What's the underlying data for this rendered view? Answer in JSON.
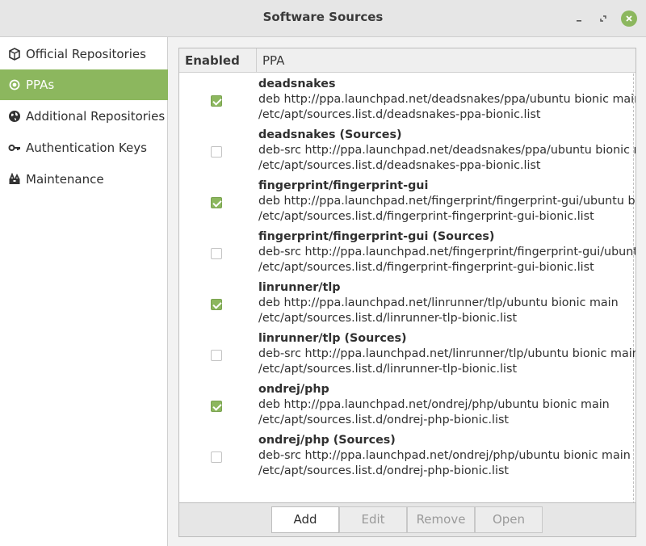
{
  "window": {
    "title": "Software Sources",
    "accent_color": "#8cb75e"
  },
  "window_controls": [
    "minimize-icon",
    "maximize-icon",
    "close-icon"
  ],
  "sidebar": {
    "items": [
      {
        "label": "Official Repositories",
        "icon": "package-icon",
        "active": false
      },
      {
        "label": "PPAs",
        "icon": "radio-dot-icon",
        "active": true
      },
      {
        "label": "Additional Repositories",
        "icon": "globe-icon",
        "active": false
      },
      {
        "label": "Authentication Keys",
        "icon": "key-icon",
        "active": false
      },
      {
        "label": "Maintenance",
        "icon": "toolbox-icon",
        "active": false
      }
    ]
  },
  "table": {
    "columns": [
      "Enabled",
      "PPA"
    ],
    "rows": [
      {
        "enabled": true,
        "name": "deadsnakes",
        "line": "deb http://ppa.launchpad.net/deadsnakes/ppa/ubuntu bionic main",
        "file": "/etc/apt/sources.list.d/deadsnakes-ppa-bionic.list"
      },
      {
        "enabled": false,
        "name": "deadsnakes (Sources)",
        "line": "deb-src http://ppa.launchpad.net/deadsnakes/ppa/ubuntu bionic main",
        "file": "/etc/apt/sources.list.d/deadsnakes-ppa-bionic.list"
      },
      {
        "enabled": true,
        "name": "fingerprint/fingerprint-gui",
        "line": "deb http://ppa.launchpad.net/fingerprint/fingerprint-gui/ubuntu bionic main",
        "file": "/etc/apt/sources.list.d/fingerprint-fingerprint-gui-bionic.list"
      },
      {
        "enabled": false,
        "name": "fingerprint/fingerprint-gui (Sources)",
        "line": "deb-src http://ppa.launchpad.net/fingerprint/fingerprint-gui/ubuntu bionic main",
        "file": "/etc/apt/sources.list.d/fingerprint-fingerprint-gui-bionic.list"
      },
      {
        "enabled": true,
        "name": "linrunner/tlp",
        "line": "deb http://ppa.launchpad.net/linrunner/tlp/ubuntu bionic main",
        "file": "/etc/apt/sources.list.d/linrunner-tlp-bionic.list"
      },
      {
        "enabled": false,
        "name": "linrunner/tlp (Sources)",
        "line": "deb-src http://ppa.launchpad.net/linrunner/tlp/ubuntu bionic main",
        "file": "/etc/apt/sources.list.d/linrunner-tlp-bionic.list"
      },
      {
        "enabled": true,
        "name": "ondrej/php",
        "line": "deb http://ppa.launchpad.net/ondrej/php/ubuntu bionic main",
        "file": "/etc/apt/sources.list.d/ondrej-php-bionic.list"
      },
      {
        "enabled": false,
        "name": "ondrej/php (Sources)",
        "line": "deb-src http://ppa.launchpad.net/ondrej/php/ubuntu bionic main",
        "file": "/etc/apt/sources.list.d/ondrej-php-bionic.list"
      }
    ]
  },
  "toolbar": {
    "add": "Add",
    "edit": "Edit",
    "remove": "Remove",
    "open": "Open"
  }
}
